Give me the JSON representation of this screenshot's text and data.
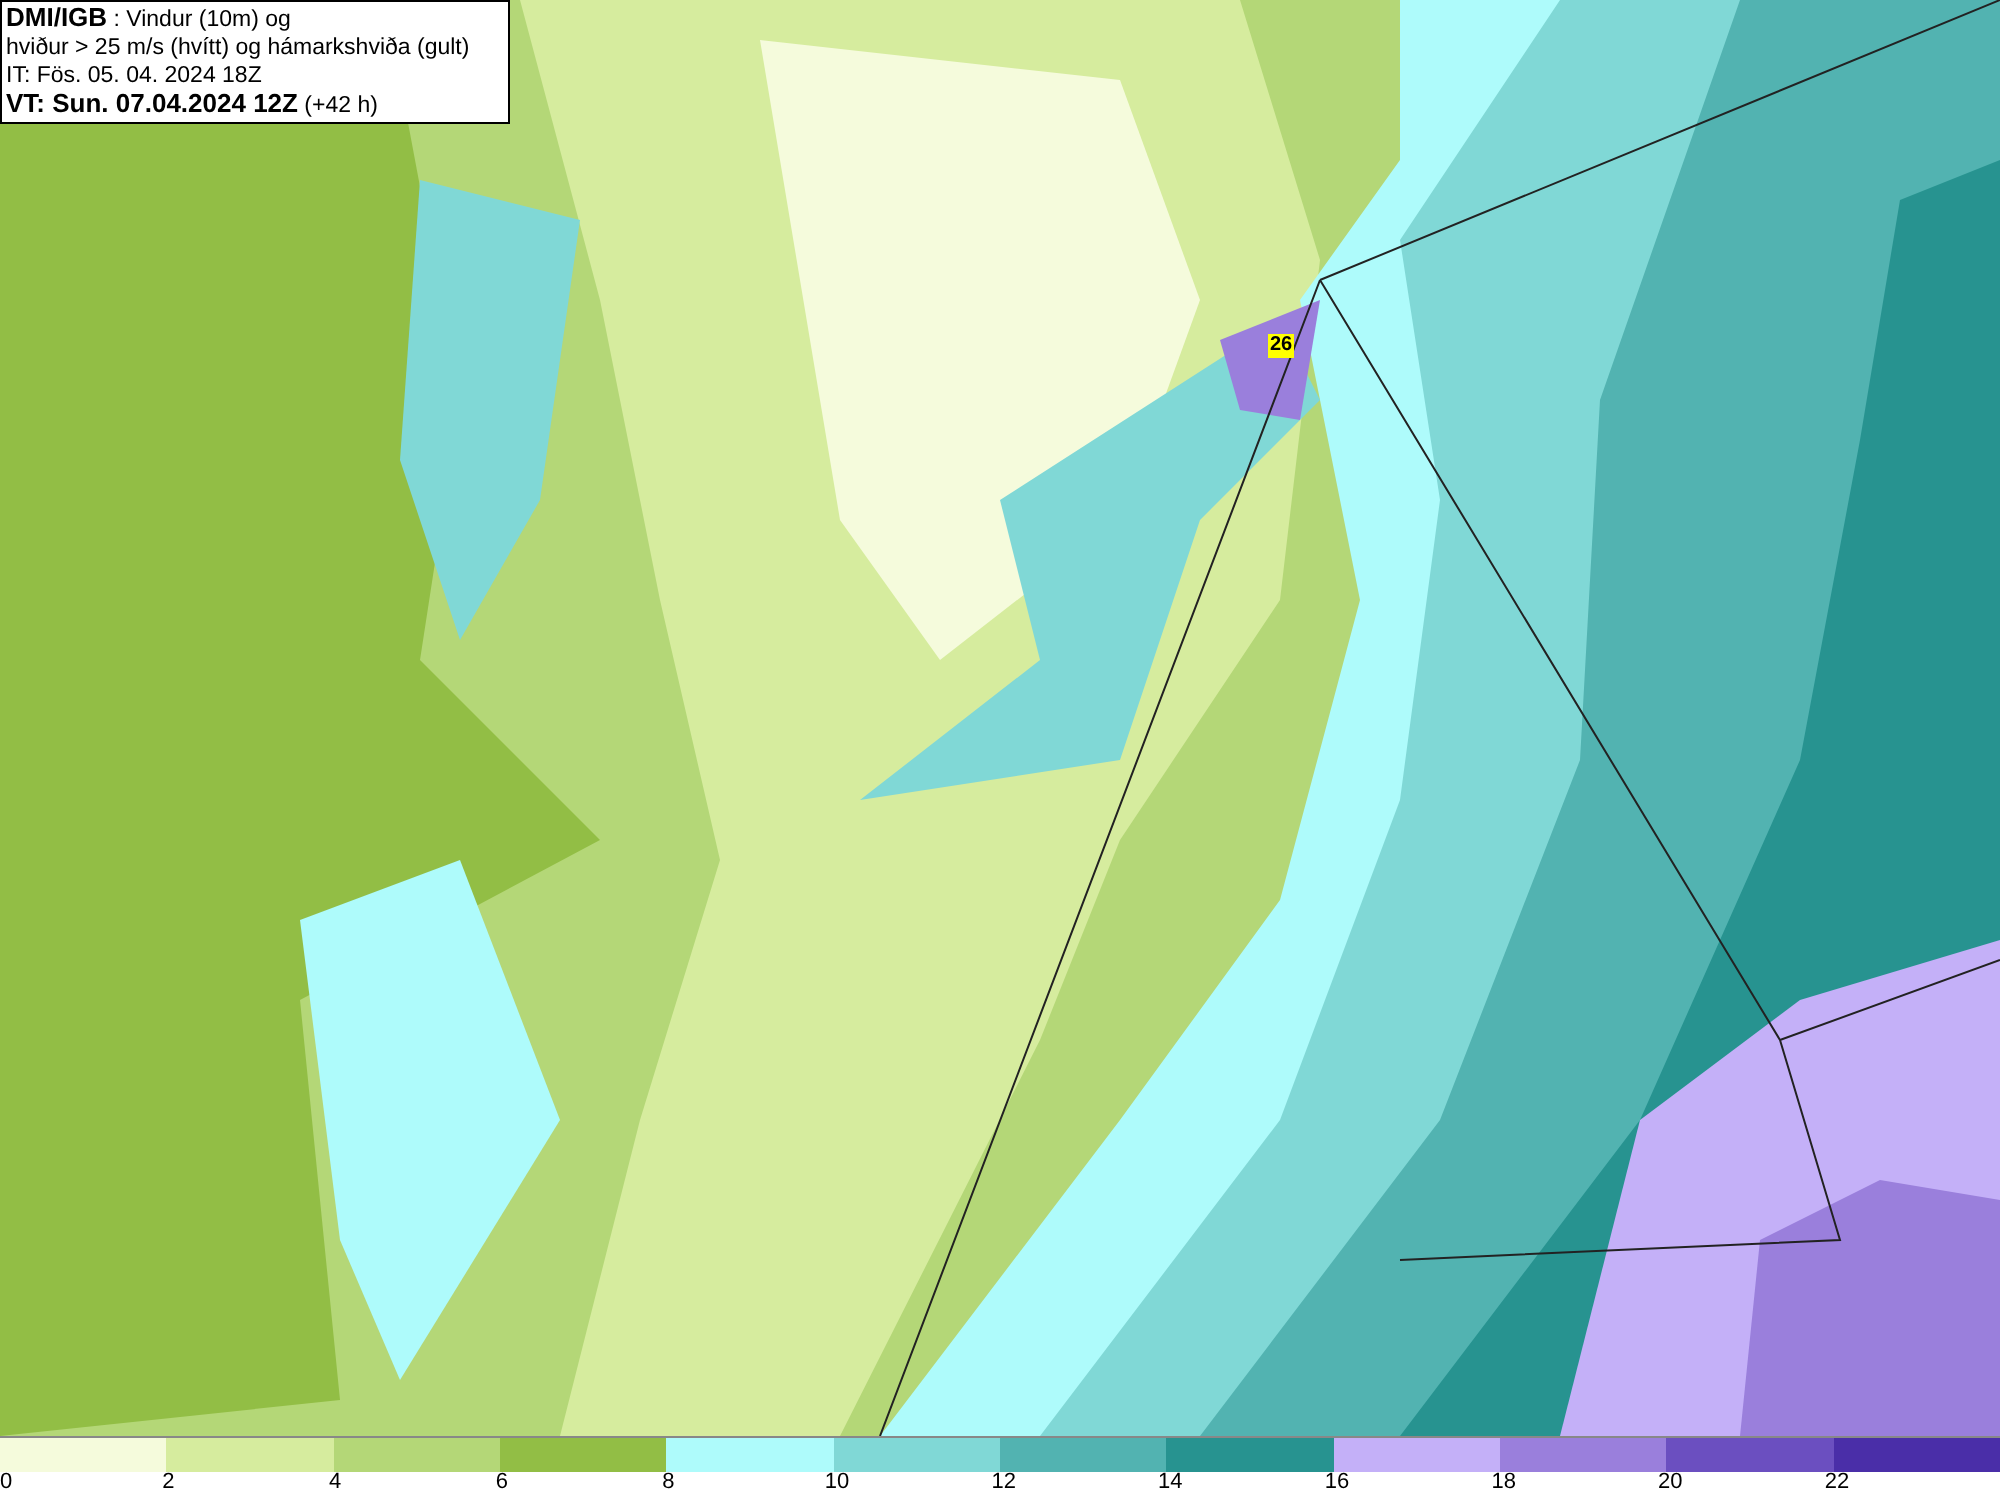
{
  "header": {
    "lines": [
      "**DMI/IGB** : Vindur (10m) og",
      "hviður > 25 m/s (hvítt) og hámarkshviða (gult)",
      "IT: Fös. 05. 04. 2024 18Z",
      "**VT: Sun. 07.04.2024 12Z** (+42 h)"
    ]
  },
  "map": {
    "gust_label": "26"
  },
  "legend": {
    "swatches": [
      {
        "color": "#f5fbdc",
        "label": "0"
      },
      {
        "color": "#d6ec9e",
        "label": "2"
      },
      {
        "color": "#b4d777",
        "label": "4"
      },
      {
        "color": "#92be45",
        "label": "6"
      },
      {
        "color": "#aefbfb",
        "label": "8"
      },
      {
        "color": "#80d8d6",
        "label": "10"
      },
      {
        "color": "#52b3b1",
        "label": "12"
      },
      {
        "color": "#279390",
        "label": "14"
      },
      {
        "color": "#c4b0f8",
        "label": "16"
      },
      {
        "color": "#9a7fdc",
        "label": "18"
      },
      {
        "color": "#6b4fc0",
        "label": "20"
      },
      {
        "color": "#4a2ea8",
        "label": "22"
      }
    ]
  }
}
